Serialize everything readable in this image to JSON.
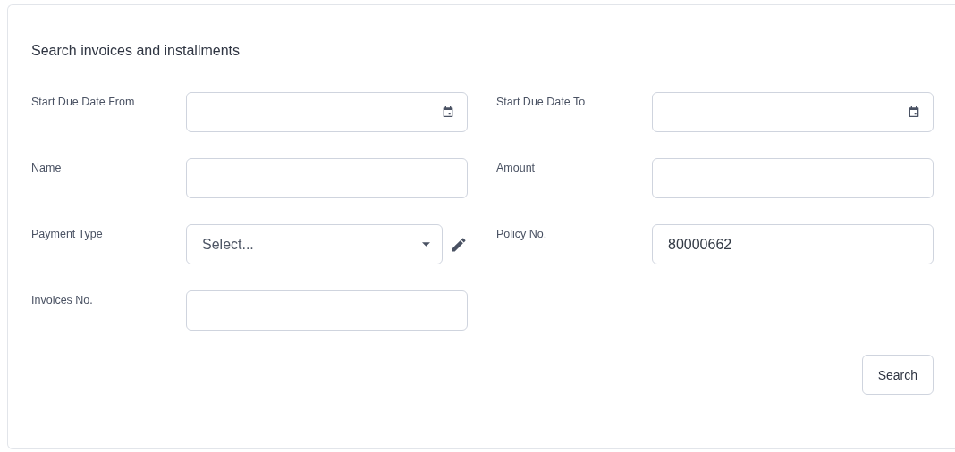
{
  "title": "Search invoices and installments",
  "fields": [
    {
      "label": "Start Due Date From",
      "kind": "date"
    },
    {
      "label": "Start Due Date To",
      "kind": "date"
    },
    {
      "label": "Name",
      "kind": "text"
    },
    {
      "label": "Amount",
      "kind": "text"
    },
    {
      "label": "Payment Type",
      "kind": "select",
      "placeholder": "Select...",
      "editable": true
    },
    {
      "label": "Policy No.",
      "kind": "text",
      "value": "80000662"
    },
    {
      "label": "Invoices No.",
      "kind": "text"
    }
  ],
  "buttons": [
    {
      "label": "Search"
    }
  ]
}
